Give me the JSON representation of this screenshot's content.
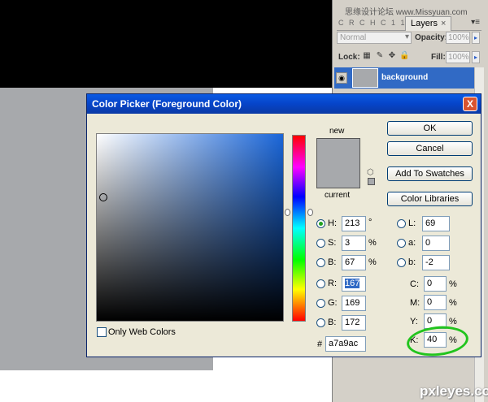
{
  "watermark_top": "思缘设计论坛 www.Missyuan.com",
  "watermark_bottom": "pxleyes.com",
  "layers_panel": {
    "tab_prefix": "C R C H C 1 1",
    "tab_label": "Layers",
    "tab_close": "×",
    "menu_icon": "▾≡",
    "blend_mode": "Normal",
    "opacity_label": "Opacity:",
    "opacity_value": "100%",
    "lock_label": "Lock:",
    "fill_label": "Fill:",
    "fill_value": "100%",
    "layer_name": "background",
    "layer_color": "#a7a9ac"
  },
  "dialog": {
    "title": "Color Picker (Foreground Color)",
    "close": "X",
    "label_new": "new",
    "label_current": "current",
    "color_new": "#a7a9ac",
    "color_current": "#a7a9ac",
    "buttons": {
      "ok": "OK",
      "cancel": "Cancel",
      "add_swatches": "Add To Swatches",
      "color_libraries": "Color Libraries"
    },
    "hsb": {
      "h_label": "H:",
      "h_value": "213",
      "h_unit": "°",
      "s_label": "S:",
      "s_value": "3",
      "s_unit": "%",
      "b_label": "B:",
      "b_value": "67",
      "b_unit": "%"
    },
    "rgb": {
      "r_label": "R:",
      "r_value": "167",
      "g_label": "G:",
      "g_value": "169",
      "b_label": "B:",
      "b_value": "172"
    },
    "lab": {
      "l_label": "L:",
      "l_value": "69",
      "a_label": "a:",
      "a_value": "0",
      "b_label": "b:",
      "b_value": "-2"
    },
    "cmyk": {
      "c_label": "C:",
      "c_value": "0",
      "c_unit": "%",
      "m_label": "M:",
      "m_value": "0",
      "m_unit": "%",
      "y_label": "Y:",
      "y_value": "0",
      "y_unit": "%",
      "k_label": "K:",
      "k_value": "40",
      "k_unit": "%"
    },
    "hex_label": "#",
    "hex_value": "a7a9ac",
    "web_colors_label": "Only Web Colors",
    "selected_channel": "H"
  }
}
